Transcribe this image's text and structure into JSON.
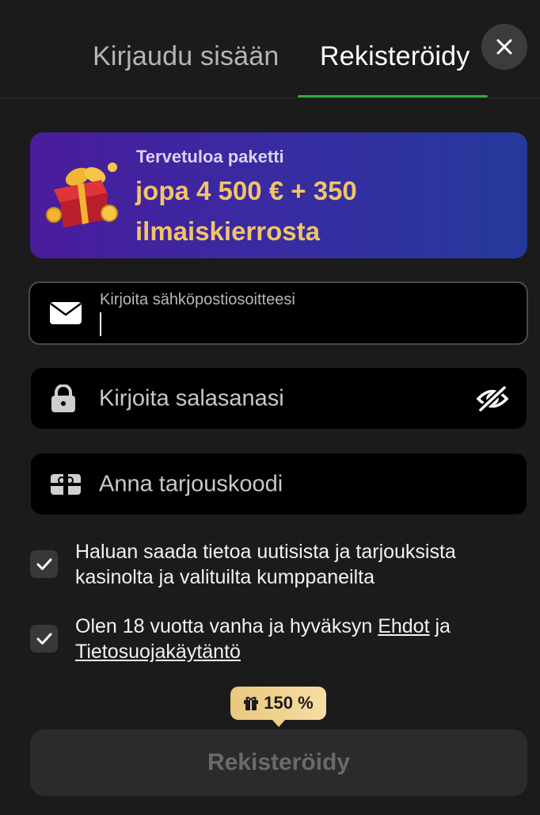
{
  "tabs": {
    "login": "Kirjaudu sisään",
    "register": "Rekisteröidy",
    "active": "register",
    "accent_color": "#2faa45"
  },
  "close_icon": "close-icon",
  "banner": {
    "title": "Tervetuloa paketti",
    "offer": "jopa 4 500 € + 350 ilmaiskierrosta",
    "icon": "gift-box-icon"
  },
  "form": {
    "email": {
      "label": "Kirjoita sähköpostiosoitteesi",
      "value": "",
      "icon": "envelope-icon"
    },
    "password": {
      "placeholder": "Kirjoita salasanasi",
      "icon": "lock-icon",
      "toggle_icon": "eye-off-icon"
    },
    "promo": {
      "placeholder": "Anna tarjouskoodi",
      "icon": "gift-card-icon"
    }
  },
  "consents": {
    "marketing": {
      "text": "Haluan saada tietoa uutisista ja tarjouksista kasinolta ja valituilta kumppaneilta",
      "checked": true
    },
    "terms": {
      "text_before": "Olen 18 vuotta vanha ja hyväksyn",
      "terms_link": "Ehdot",
      "text_and": "ja",
      "privacy_link": "Tietosuojakäytäntö",
      "checked": true
    }
  },
  "bonus_badge": {
    "value": "150 %",
    "icon": "gift-icon"
  },
  "submit": {
    "label": "Rekisteröidy",
    "enabled": false
  }
}
